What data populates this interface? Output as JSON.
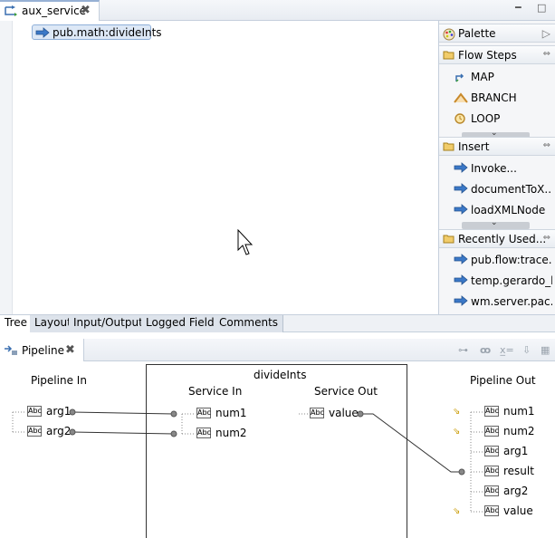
{
  "editor": {
    "tab_title": "aux_service",
    "close": "✖",
    "minimize": "━",
    "maximize": "□"
  },
  "flow": {
    "steps": [
      {
        "label": "pub.math:divideInts",
        "icon": "invoke-arrow-icon"
      }
    ]
  },
  "palette": {
    "title": "Palette",
    "sections": [
      {
        "label": "Flow Steps",
        "items": [
          {
            "label": "MAP",
            "icon": "map-icon"
          },
          {
            "label": "BRANCH",
            "icon": "branch-icon"
          },
          {
            "label": "LOOP",
            "icon": "loop-icon"
          }
        ]
      },
      {
        "label": "Insert",
        "items": [
          {
            "label": "Invoke...",
            "icon": "invoke-arrow-icon"
          },
          {
            "label": "documentToX...",
            "icon": "invoke-arrow-icon"
          },
          {
            "label": "loadXMLNode",
            "icon": "invoke-arrow-icon"
          }
        ]
      },
      {
        "label": "Recently Used...",
        "items": [
          {
            "label": "pub.flow:trace...",
            "icon": "invoke-arrow-icon"
          },
          {
            "label": "temp.gerardo_l...",
            "icon": "invoke-arrow-icon"
          },
          {
            "label": "wm.server.pac...",
            "icon": "invoke-arrow-icon"
          }
        ]
      }
    ]
  },
  "editor_tabs": [
    "Tree",
    "Layout",
    "Input/Output",
    "Logged Fields",
    "Comments"
  ],
  "pipeline_view": {
    "tab_title": "Pipeline",
    "close": "✖"
  },
  "pipeline": {
    "pipeline_in_title": "Pipeline In",
    "service_title": "divideInts",
    "service_in_title": "Service In",
    "service_out_title": "Service Out",
    "pipeline_out_title": "Pipeline Out",
    "type_badge": "Abc",
    "pipeline_in": [
      "arg1",
      "arg2"
    ],
    "service_in": [
      "num1",
      "num2"
    ],
    "service_out": [
      "value"
    ],
    "pipeline_out": [
      "num1",
      "num2",
      "arg1",
      "result",
      "arg2",
      "value"
    ]
  }
}
